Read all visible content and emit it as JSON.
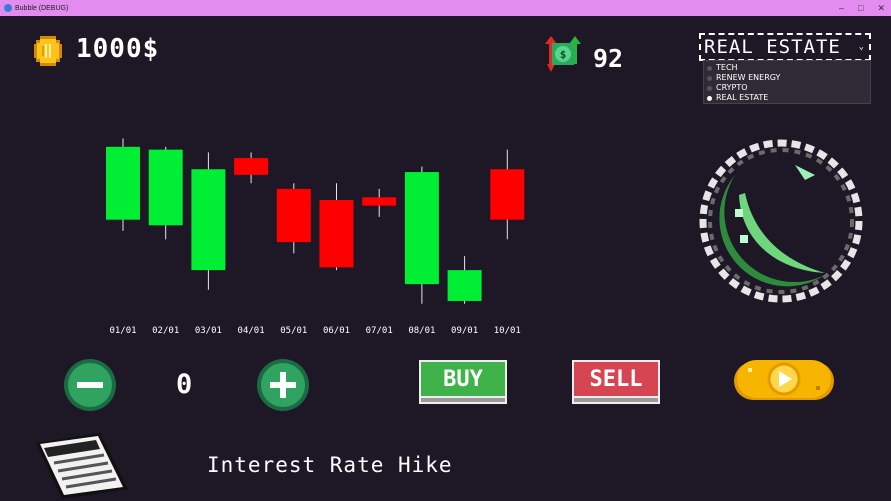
{
  "window": {
    "title": "Bubble (DEBUG)",
    "minimize": "–",
    "maximize": "□",
    "close": "✕"
  },
  "hud": {
    "money": "1000$",
    "shares": "92",
    "coin_icon": "coin-icon",
    "stock_icon": "money-arrows-icon"
  },
  "sector": {
    "selected": "REAL ESTATE",
    "options": [
      {
        "label": "TECH",
        "selected": false
      },
      {
        "label": "RENEW ENERGY",
        "selected": false
      },
      {
        "label": "CRYPTO",
        "selected": false
      },
      {
        "label": "REAL ESTATE",
        "selected": true
      }
    ]
  },
  "chart_data": {
    "type": "candlestick",
    "categories": [
      "01/01",
      "02/01",
      "03/01",
      "04/01",
      "05/01",
      "06/01",
      "07/01",
      "08/01",
      "09/01",
      "10/01"
    ],
    "candles": [
      {
        "open": 74,
        "close": 100,
        "high": 103,
        "low": 70,
        "dir": "up"
      },
      {
        "open": 72,
        "close": 99,
        "high": 100,
        "low": 67,
        "dir": "up"
      },
      {
        "open": 56,
        "close": 92,
        "high": 98,
        "low": 49,
        "dir": "up"
      },
      {
        "open": 96,
        "close": 90,
        "high": 98,
        "low": 87,
        "dir": "down"
      },
      {
        "open": 85,
        "close": 66,
        "high": 87,
        "low": 62,
        "dir": "down"
      },
      {
        "open": 81,
        "close": 57,
        "high": 87,
        "low": 56,
        "dir": "down"
      },
      {
        "open": 82,
        "close": 79,
        "high": 85,
        "low": 75,
        "dir": "down"
      },
      {
        "open": 51,
        "close": 91,
        "high": 93,
        "low": 44,
        "dir": "up"
      },
      {
        "open": 45,
        "close": 56,
        "high": 61,
        "low": 44,
        "dir": "up"
      },
      {
        "open": 92,
        "close": 74,
        "high": 99,
        "low": 67,
        "dir": "down"
      }
    ],
    "ylim": [
      40,
      106
    ],
    "colors": {
      "up": "#00ee33",
      "down": "#ff0000"
    }
  },
  "controls": {
    "quantity": "0",
    "buy_label": "BUY",
    "sell_label": "SELL"
  },
  "news": {
    "headline": "Interest Rate Hike",
    "icon_text": "NEWS"
  },
  "colors": {
    "background": "#1d1726",
    "up": "#00ee33",
    "down": "#ff0000",
    "buy": "#3fb34a",
    "sell": "#d64552",
    "play": "#f7b500"
  }
}
